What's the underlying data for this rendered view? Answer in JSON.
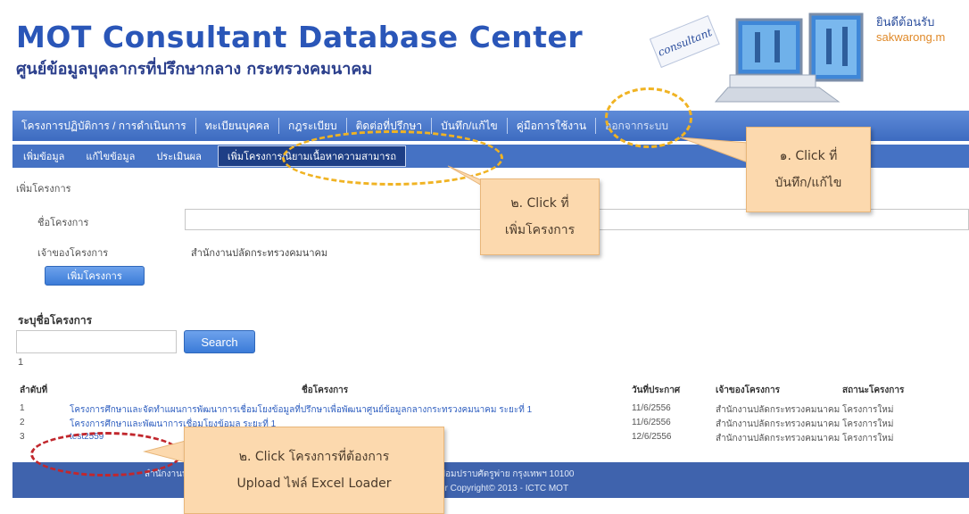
{
  "header": {
    "title_en": "MOT Consultant Database Center",
    "title_th": "ศูนย์ข้อมูลบุคลากรที่ปรึกษากลาง กระทรวงคมนาคม",
    "graphic_label": "consultant",
    "welcome": "ยินดีต้อนรับ",
    "username": "sakwarong.m"
  },
  "menu": [
    "โครงการปฏิบัติการ / การดำเนินการ",
    "ทะเบียนบุคคล",
    "กฎระเบียบ",
    "ติดต่อที่ปรึกษา",
    "บันทึก/แก้ไข",
    "คู่มือการใช้งาน",
    "ออกจากระบบ"
  ],
  "submenu": [
    "เพิ่มข้อมูล",
    "แก้ไขข้อมูล",
    "ประเมินผล",
    "เพิ่มโครงการ/นิยามเนื้อหาความสามารถ"
  ],
  "form": {
    "section": "เพิ่มโครงการ",
    "name_label": "ชื่อโครงการ",
    "owner_label": "เจ้าของโครงการ",
    "owner_value": "สำนักงานปลัดกระทรวงคมนาคม",
    "add_button": "เพิ่มโครงการ"
  },
  "search": {
    "label": "ระบุชื่อโครงการ",
    "button": "Search",
    "count": "1"
  },
  "table": {
    "headers": [
      "ลำดับที่",
      "ชื่อโครงการ",
      "วันที่ประกาศ",
      "เจ้าของโครงการ",
      "สถานะโครงการ"
    ],
    "rows": [
      {
        "no": "1",
        "name": "โครงการศึกษาและจัดทำแผนการพัฒนาการเชื่อมโยงข้อมูลที่ปรึกษาเพื่อพัฒนาศูนย์ข้อมูลกลางกระทรวงคมนาคม ระยะที่ 1",
        "date": "11/6/2556",
        "owner": "สำนักงานปลัดกระทรวงคมนาคม",
        "status": "โครงการใหม่"
      },
      {
        "no": "2",
        "name": "โครงการศึกษาและพัฒนาการเชื่อมโยงข้อมูล ระยะที่ 1",
        "date": "11/6/2556",
        "owner": "สำนักงานปลัดกระทรวงคมนาคม",
        "status": "โครงการใหม่"
      },
      {
        "no": "3",
        "name": "test2559",
        "date": "12/6/2556",
        "owner": "สำนักงานปลัดกระทรวงคมนาคม",
        "status": "โครงการใหม่"
      }
    ]
  },
  "footer": {
    "line1": "สำนักงานปลัดกระทรวงคมนาคม 38 ถนนราชดำเนินนอก แขวงวัดโสมนัส เขตป้อมปราบศัตรูพ่าย กรุงเทพฯ 10100",
    "line2": "โทร 0 2283 3859  อีเมล : webmaster  Copyright© 2013 - ICTC MOT"
  },
  "annotations": {
    "step1_line1": "๑. Click ที่",
    "step1_line2": "บันทึก/แก้ไข",
    "step2_line1": "๒. Click ที่",
    "step2_line2": "เพิ่มโครงการ",
    "step3_line1": "๒. Click โครงการที่ต้องการ",
    "step3_line2": "Upload ไฟล์ Excel Loader",
    "orange": "#f0b323",
    "red": "#c1272d",
    "callout_bg": "#fcd9ae"
  },
  "colors": {
    "menu_bg": "#4572c4",
    "title": "#2a56b8",
    "footer_bg": "#3f63ad"
  }
}
